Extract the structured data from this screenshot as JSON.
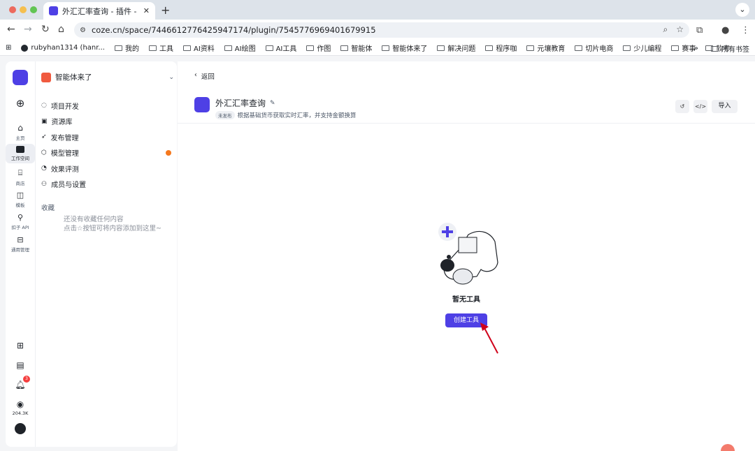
{
  "browser": {
    "tab_title": "外汇汇率查询 - 插件 - 扣子",
    "new_tab_symbol": "+",
    "url": "coze.cn/space/7446612776425947174/plugin/7545776969401679915",
    "bookmarks": [
      {
        "label": "rubyhan1314 (hanr...",
        "icon": "github-icon"
      },
      {
        "label": "我的",
        "icon": "folder-icon"
      },
      {
        "label": "工具",
        "icon": "folder-icon"
      },
      {
        "label": "AI资料",
        "icon": "folder-icon"
      },
      {
        "label": "AI绘图",
        "icon": "folder-icon"
      },
      {
        "label": "AI工具",
        "icon": "folder-icon"
      },
      {
        "label": "作图",
        "icon": "folder-icon"
      },
      {
        "label": "智能体",
        "icon": "folder-icon"
      },
      {
        "label": "智能体来了",
        "icon": "folder-icon"
      },
      {
        "label": "解决问题",
        "icon": "folder-icon"
      },
      {
        "label": "程序咖",
        "icon": "folder-icon"
      },
      {
        "label": "元壤教育",
        "icon": "folder-icon"
      },
      {
        "label": "切片电商",
        "icon": "folder-icon"
      },
      {
        "label": "少儿编程",
        "icon": "folder-icon"
      },
      {
        "label": "赛事",
        "icon": "folder-icon"
      },
      {
        "label": "软考",
        "icon": "folder-icon"
      }
    ],
    "bookmarks_overflow": "»",
    "all_bookmarks": "所有书签"
  },
  "rail": {
    "items": [
      {
        "label": "主页",
        "icon": "home-icon"
      },
      {
        "label": "工作空间",
        "icon": "terminal-icon"
      },
      {
        "label": "商店",
        "icon": "store-icon"
      },
      {
        "label": "模板",
        "icon": "template-icon"
      },
      {
        "label": "扣子 API",
        "icon": "api-icon"
      },
      {
        "label": "通用管理",
        "icon": "briefcase-icon"
      }
    ],
    "notification_count": "3",
    "points": "204.3K"
  },
  "sidebar": {
    "workspace_name": "智能体来了",
    "menu": [
      {
        "label": "项目开发",
        "icon": "chat-icon"
      },
      {
        "label": "资源库",
        "icon": "library-icon"
      },
      {
        "label": "发布管理",
        "icon": "rocket-icon"
      },
      {
        "label": "模型管理",
        "icon": "cube-icon"
      },
      {
        "label": "效果评测",
        "icon": "gauge-icon"
      },
      {
        "label": "成员与设置",
        "icon": "members-icon"
      }
    ],
    "favorites_title": "收藏",
    "favorites_empty_line1": "还没有收藏任何内容",
    "favorites_empty_line2": "点击☆按钮可将内容添加到这里~"
  },
  "main": {
    "back_label": "返回",
    "plugin_title": "外汇汇率查询",
    "status_pill": "未发布",
    "plugin_desc": "根据基础货币获取实时汇率，并支持金额换算",
    "import_label": "导入",
    "empty_text": "暂无工具",
    "create_button": "创建工具"
  }
}
